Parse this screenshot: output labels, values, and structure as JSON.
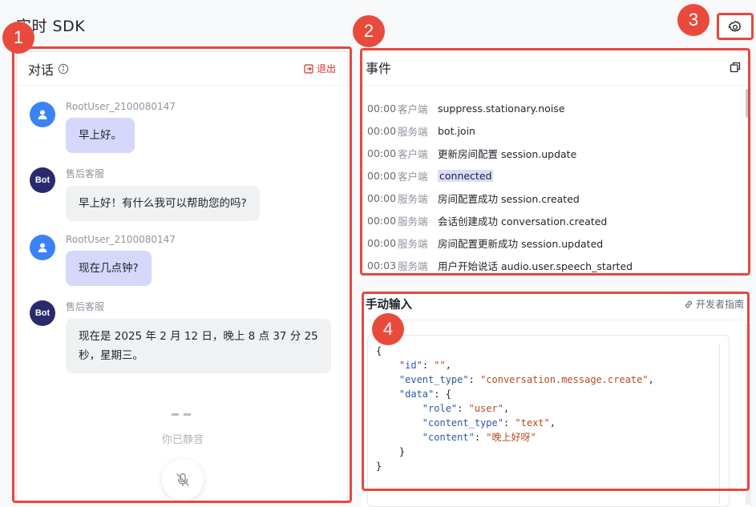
{
  "app_title": "实时 SDK",
  "chat": {
    "title": "对话",
    "exit_label": "退出",
    "messages": [
      {
        "sender": "RootUser_2100080147",
        "role": "user",
        "text": "早上好。"
      },
      {
        "sender": "售后客服",
        "role": "bot",
        "avatar": "Bot",
        "text": "早上好！有什么我可以帮助您的吗?"
      },
      {
        "sender": "RootUser_2100080147",
        "role": "user",
        "text": "现在几点钟?"
      },
      {
        "sender": "售后客服",
        "role": "bot",
        "avatar": "Bot",
        "text_line1": "现在是 2025 年 2 月 12 日，晚上 8 点 37 分 25",
        "text_line2": "秒，星期三。"
      }
    ],
    "mute_text": "你已静音"
  },
  "events": {
    "title": "事件",
    "rows": [
      {
        "time": "00:00",
        "source": "客户端",
        "text": "suppress.stationary.noise"
      },
      {
        "time": "00:00",
        "source": "服务端",
        "text": "bot.join"
      },
      {
        "time": "00:00",
        "source": "客户端",
        "text": "更新房间配置 session.update"
      },
      {
        "time": "00:00",
        "source": "客户端",
        "text": "connected"
      },
      {
        "time": "00:00",
        "source": "服务端",
        "text": "房间配置成功 session.created"
      },
      {
        "time": "00:00",
        "source": "服务端",
        "text": "会话创建成功 conversation.created"
      },
      {
        "time": "00:00",
        "source": "服务端",
        "text": "房间配置更新成功 session.updated"
      },
      {
        "time": "00:03",
        "source": "服务端",
        "text": "用户开始说话 audio.user.speech_started"
      }
    ]
  },
  "manual_input": {
    "title": "手动输入",
    "guide_label": "开发者指南",
    "code": {
      "id_value": "\"\"",
      "event_type_value": "\"conversation.message.create\"",
      "role_value": "\"user\"",
      "content_type_value": "\"text\"",
      "content_value": "\"晚上好呀\""
    }
  },
  "annotations": [
    "1",
    "2",
    "3",
    "4"
  ],
  "icons": {
    "settings": "gear-icon",
    "info": "info-icon",
    "exit": "exit-icon",
    "copy": "copy-icon",
    "link": "link-icon",
    "mic": "mic-muted-icon",
    "user_avatar": "user-icon"
  },
  "colors": {
    "annotation": "#e5483f",
    "user_bubble": "#d5d8fb",
    "bot_bubble": "#f0f1f3",
    "user_avatar": "#3b82f6",
    "bot_avatar": "#2a2b6e",
    "exit": "#d93026"
  }
}
